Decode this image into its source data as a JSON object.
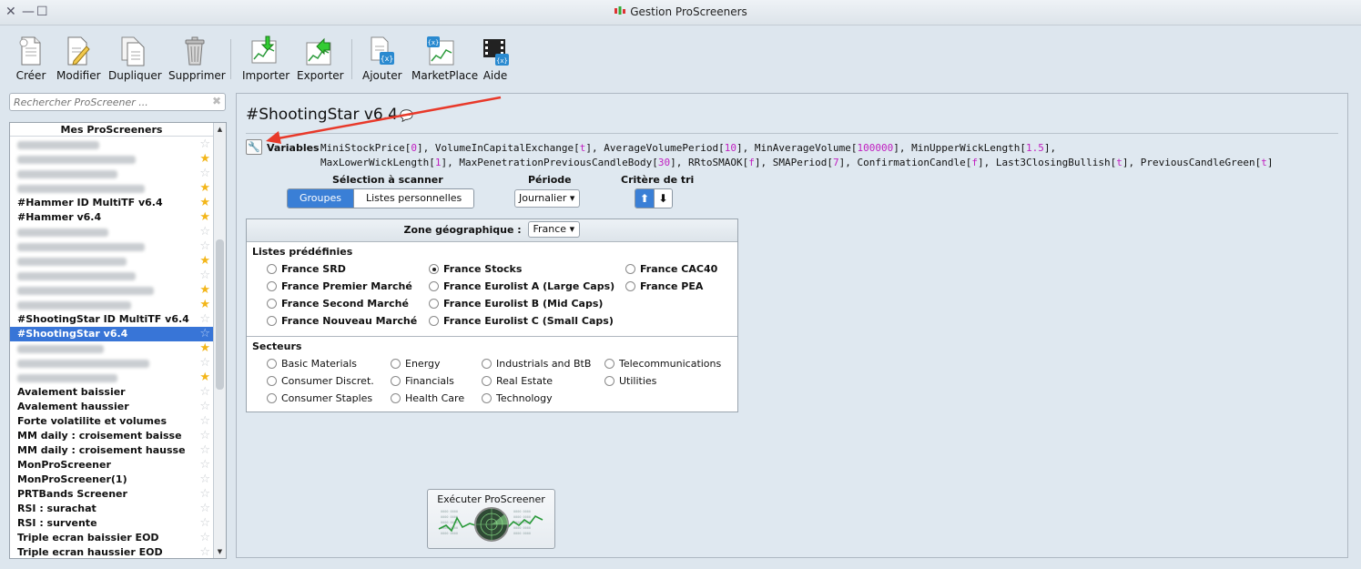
{
  "window": {
    "title": "Gestion ProScreeners"
  },
  "toolbar": {
    "create": "Créer",
    "modify": "Modifier",
    "duplicate": "Dupliquer",
    "delete": "Supprimer",
    "import": "Importer",
    "export": "Exporter",
    "add": "Ajouter",
    "marketplace": "MarketPlace",
    "help": "Aide"
  },
  "search": {
    "placeholder": "Rechercher ProScreener ..."
  },
  "list": {
    "header": "Mes ProScreeners",
    "items": [
      {
        "label": "",
        "blurred": true,
        "favorite": false
      },
      {
        "label": "",
        "blurred": true,
        "favorite": true
      },
      {
        "label": "",
        "blurred": true,
        "favorite": false
      },
      {
        "label": "",
        "blurred": true,
        "favorite": true
      },
      {
        "label": "#Hammer ID MultiTF v6.4",
        "favorite": true
      },
      {
        "label": "#Hammer v6.4",
        "favorite": true
      },
      {
        "label": "",
        "blurred": true,
        "favorite": false
      },
      {
        "label": "",
        "blurred": true,
        "favorite": false
      },
      {
        "label": "",
        "blurred": true,
        "favorite": true
      },
      {
        "label": "",
        "blurred": true,
        "favorite": false
      },
      {
        "label": "",
        "blurred": true,
        "favorite": true
      },
      {
        "label": "",
        "blurred": true,
        "favorite": true
      },
      {
        "label": "#ShootingStar ID MultiTF v6.4",
        "favorite": false
      },
      {
        "label": "#ShootingStar v6.4",
        "favorite": false,
        "selected": true
      },
      {
        "label": "",
        "blurred": true,
        "favorite": true
      },
      {
        "label": "",
        "blurred": true,
        "favorite": false
      },
      {
        "label": "",
        "blurred": true,
        "favorite": true
      },
      {
        "label": "Avalement baissier",
        "favorite": false
      },
      {
        "label": "Avalement haussier",
        "favorite": false
      },
      {
        "label": "Forte volatilite et volumes",
        "favorite": false
      },
      {
        "label": "MM daily : croisement baisse",
        "favorite": false
      },
      {
        "label": "MM daily : croisement hausse",
        "favorite": false
      },
      {
        "label": "MonProScreener",
        "favorite": false
      },
      {
        "label": "MonProScreener(1)",
        "favorite": false
      },
      {
        "label": "PRTBands Screener",
        "favorite": false
      },
      {
        "label": "RSI : surachat",
        "favorite": false
      },
      {
        "label": "RSI : survente",
        "favorite": false
      },
      {
        "label": "Triple ecran baissier EOD",
        "favorite": false
      },
      {
        "label": "Triple ecran haussier EOD",
        "favorite": false
      }
    ]
  },
  "screener": {
    "title": "#ShootingStar v6.4",
    "variables_label": "Variables",
    "variables": [
      [
        {
          "name": "MiniStockPrice",
          "value": "0"
        },
        {
          "name": "VolumeInCapitalExchange",
          "value": "t"
        },
        {
          "name": "AverageVolumePeriod",
          "value": "10"
        },
        {
          "name": "MinAverageVolume",
          "value": "100000"
        },
        {
          "name": "MinUpperWickLength",
          "value": "1.5"
        }
      ],
      [
        {
          "name": "MaxLowerWickLength",
          "value": "1"
        },
        {
          "name": "MaxPenetrationPreviousCandleBody",
          "value": "30"
        },
        {
          "name": "RRtoSMAOK",
          "value": "f"
        },
        {
          "name": "SMAPeriod",
          "value": "7"
        },
        {
          "name": "ConfirmationCandle",
          "value": "f"
        },
        {
          "name": "Last3ClosingBullish",
          "value": "t"
        },
        {
          "name": "PreviousCandleGreen",
          "value": "t"
        }
      ]
    ],
    "selection_header": "Sélection à scanner",
    "groups_btn": "Groupes",
    "personal_lists_btn": "Listes personnelles",
    "period_header": "Période",
    "period_value": "Journalier",
    "sort_header": "Critère de tri",
    "sort_up": "⬆",
    "sort_down": "⬇",
    "zone_label": "Zone géographique :",
    "zone_value": "France",
    "predefined_header": "Listes prédéfinies",
    "predefined": [
      {
        "label": "France SRD",
        "checked": false
      },
      {
        "label": "France Premier Marché",
        "checked": false
      },
      {
        "label": "France Second Marché",
        "checked": false
      },
      {
        "label": "France Nouveau Marché",
        "checked": false
      },
      {
        "label": "France Stocks",
        "checked": true
      },
      {
        "label": "France Eurolist A (Large Caps)",
        "checked": false
      },
      {
        "label": "France Eurolist B (Mid Caps)",
        "checked": false
      },
      {
        "label": "France Eurolist C (Small Caps)",
        "checked": false
      },
      {
        "label": "France CAC40",
        "checked": false
      },
      {
        "label": "France PEA",
        "checked": false
      }
    ],
    "sectors_header": "Secteurs",
    "sectors": [
      {
        "label": "Basic Materials"
      },
      {
        "label": "Consumer Discret."
      },
      {
        "label": "Consumer Staples"
      },
      {
        "label": "Energy"
      },
      {
        "label": "Financials"
      },
      {
        "label": "Health Care"
      },
      {
        "label": "Industrials and BtB"
      },
      {
        "label": "Real Estate"
      },
      {
        "label": "Technology"
      },
      {
        "label": "Telecommunications"
      },
      {
        "label": "Utilities"
      }
    ],
    "execute_btn": "Exécuter ProScreener"
  },
  "colors": {
    "accent": "#3a7fd6",
    "selection": "#3875d7",
    "variable_value": "#c020c0",
    "annotation_arrow": "#e8392a",
    "favorite_star": "#f3b61a"
  }
}
